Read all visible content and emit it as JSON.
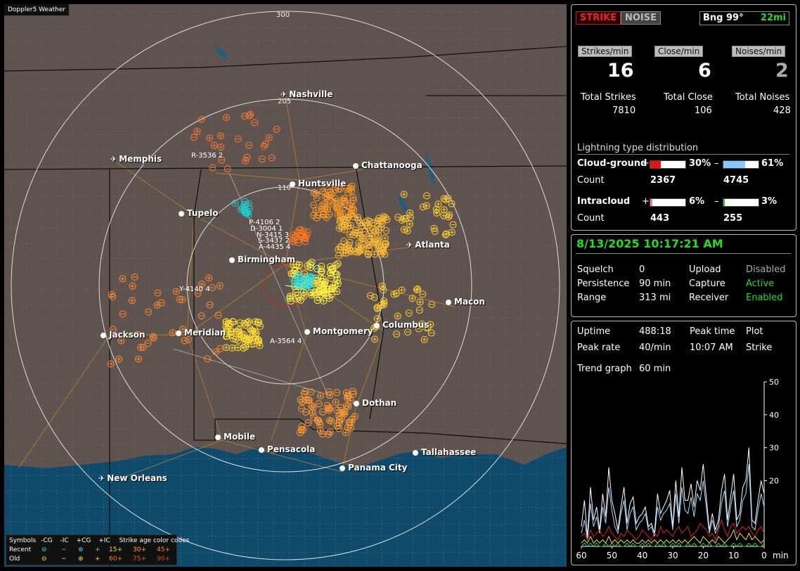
{
  "map": {
    "brand": "Doppler5 Weather",
    "ring_labels": [
      "300",
      "205",
      "110"
    ],
    "cities": [
      {
        "name": "Nashville",
        "icon": "airport-icon"
      },
      {
        "name": "Memphis",
        "icon": "airport-icon"
      },
      {
        "name": "Chattanooga",
        "icon": "city-dot"
      },
      {
        "name": "Huntsville",
        "icon": "city-dot"
      },
      {
        "name": "Tupelo",
        "icon": "city-dot"
      },
      {
        "name": "Atlanta",
        "icon": "airport-icon"
      },
      {
        "name": "Birmingham",
        "icon": "city-dot"
      },
      {
        "name": "Macon",
        "icon": "city-dot"
      },
      {
        "name": "Jackson",
        "icon": "city-dot"
      },
      {
        "name": "Meridian",
        "icon": "city-dot"
      },
      {
        "name": "Montgomery",
        "icon": "city-dot"
      },
      {
        "name": "Columbus",
        "icon": "city-dot"
      },
      {
        "name": "Dothan",
        "icon": "city-dot"
      },
      {
        "name": "Mobile",
        "icon": "city-dot"
      },
      {
        "name": "Pensacola",
        "icon": "city-dot"
      },
      {
        "name": "Tallahassee",
        "icon": "city-dot"
      },
      {
        "name": "Panama City",
        "icon": "city-dot"
      },
      {
        "name": "New Orleans",
        "icon": "airport-icon"
      }
    ],
    "stations": [
      "R-3536 2",
      "P-4106 2",
      "D-3004 1",
      "N-3415 3",
      "S-3437 2",
      "A-4435 4",
      "Y-4140 4",
      "A-3564 4"
    ],
    "legend": {
      "header": [
        "Symbols",
        "-CG",
        "-IC",
        "+CG",
        "+IC",
        "Strike age color codes"
      ],
      "recent_label": "Recent",
      "old_label": "Old",
      "recent_ages": [
        "15+",
        "30+",
        "45+"
      ],
      "old_ages": [
        "60+",
        "75+",
        "90+"
      ]
    }
  },
  "panel1": {
    "strike_button": "STRIKE",
    "noise_button": "NOISE",
    "bearing": "Bng 99°",
    "distance": "22mi",
    "headers": [
      "Strikes/min",
      "Close/min",
      "Noises/min"
    ],
    "big_values": [
      "16",
      "6",
      "2"
    ],
    "totals_labels": [
      "Total Strikes",
      "Total Close",
      "Total Noises"
    ],
    "totals_values": [
      "7810",
      "106",
      "428"
    ],
    "dist_title": "Lightning type distribution",
    "cg_label": "Cloud-ground",
    "ic_label": "Intracloud",
    "count_label": "Count",
    "plus": "+",
    "minus": "–",
    "cg_pos_pct": "30%",
    "cg_neg_pct": "61%",
    "cg_pos_count": "2367",
    "cg_neg_count": "4745",
    "ic_pos_pct": "6%",
    "ic_neg_pct": "3%",
    "ic_pos_count": "443",
    "ic_neg_count": "255",
    "cg_pos_frac": 0.3,
    "cg_neg_frac": 0.61,
    "ic_pos_frac": 0.06,
    "ic_neg_frac": 0.03
  },
  "panel2": {
    "datetime": "8/13/2025 10:17:21 AM",
    "squelch_label": "Squelch",
    "squelch": "0",
    "persistence_label": "Persistence",
    "persistence": "90 min",
    "range_label": "Range",
    "range": "313 mi",
    "upload_label": "Upload",
    "upload": "Disabled",
    "capture_label": "Capture",
    "capture": "Active",
    "receiver_label": "Receiver",
    "receiver": "Enabled"
  },
  "panel3": {
    "uptime_label": "Uptime",
    "uptime": "488:18",
    "peak_time_label": "Peak time",
    "peak_time": "10:07 AM",
    "plot_label": "Plot",
    "plot": "Strike",
    "peak_rate_label": "Peak rate",
    "peak_rate": "40/min",
    "trend_label": "Trend graph",
    "trend": "60 min"
  },
  "chart_data": {
    "type": "line",
    "x": [
      60,
      59,
      58,
      57,
      56,
      55,
      54,
      53,
      52,
      51,
      50,
      49,
      48,
      47,
      46,
      45,
      44,
      43,
      42,
      41,
      40,
      39,
      38,
      37,
      36,
      35,
      34,
      33,
      32,
      31,
      30,
      29,
      28,
      27,
      26,
      25,
      24,
      23,
      22,
      21,
      20,
      19,
      18,
      17,
      16,
      15,
      14,
      13,
      12,
      11,
      10,
      9,
      8,
      7,
      6,
      5,
      4,
      3,
      2,
      1,
      0
    ],
    "xticks": [
      "60",
      "50",
      "40",
      "30",
      "20",
      "10",
      "0"
    ],
    "xunit": "min",
    "yticks": [
      "50",
      "40",
      "30",
      "20"
    ],
    "ylim": [
      0,
      50
    ],
    "series": [
      {
        "color": "#ffffff",
        "values": [
          6,
          14,
          3,
          18,
          8,
          12,
          5,
          16,
          9,
          24,
          14,
          10,
          5,
          12,
          18,
          7,
          13,
          15,
          7,
          9,
          10,
          12,
          6,
          7,
          4,
          16,
          10,
          12,
          14,
          17,
          6,
          20,
          9,
          24,
          14,
          14,
          19,
          12,
          20,
          17,
          25,
          15,
          5,
          10,
          5,
          8,
          17,
          22,
          8,
          15,
          22,
          8,
          10,
          18,
          20,
          30,
          8,
          7,
          14,
          20,
          16
        ]
      },
      {
        "color": "#a8d8ff",
        "values": [
          4,
          8,
          2,
          13,
          6,
          9,
          4,
          12,
          7,
          18,
          11,
          6,
          4,
          10,
          14,
          5,
          10,
          12,
          5,
          7,
          8,
          10,
          5,
          6,
          3,
          12,
          8,
          10,
          11,
          13,
          5,
          16,
          7,
          18,
          11,
          10,
          15,
          9,
          16,
          14,
          20,
          12,
          4,
          8,
          4,
          6,
          13,
          17,
          6,
          12,
          17,
          6,
          8,
          14,
          16,
          25,
          6,
          5,
          11,
          16,
          12
        ]
      },
      {
        "color": "#dd2222",
        "values": [
          3,
          4,
          2,
          5,
          3,
          4,
          5,
          3,
          4,
          6,
          4,
          3,
          2,
          4,
          3,
          5,
          4,
          3,
          2,
          3,
          5,
          4,
          3,
          2,
          4,
          3,
          6,
          4,
          5,
          4,
          3,
          5,
          6,
          4,
          5,
          6,
          3,
          4,
          5,
          7,
          6,
          5,
          3,
          4,
          2,
          5,
          8,
          5,
          3,
          6,
          7,
          4,
          5,
          6,
          5,
          6,
          4,
          3,
          5,
          6,
          4
        ]
      },
      {
        "color": "#eedd55",
        "values": [
          1,
          2,
          1,
          3,
          1,
          2,
          1,
          2,
          1,
          3,
          1,
          2,
          1,
          2,
          1,
          2,
          1,
          2,
          1,
          1,
          2,
          1,
          2,
          1,
          2,
          1,
          2,
          1,
          2,
          1,
          2,
          1,
          2,
          1,
          2,
          1,
          2,
          3,
          2,
          1,
          3,
          2,
          1,
          2,
          1,
          3,
          2,
          1,
          2,
          3,
          5,
          2,
          4,
          3,
          2,
          4,
          2,
          3,
          2,
          1,
          2
        ]
      },
      {
        "color": "#33cc33",
        "values": [
          0,
          1,
          0,
          1,
          0,
          1,
          0,
          0,
          1,
          0,
          1,
          0,
          1,
          0,
          0,
          1,
          0,
          1,
          0,
          0,
          1,
          0,
          1,
          0,
          0,
          1,
          0,
          1,
          0,
          0,
          1,
          0,
          1,
          0,
          0,
          1,
          0,
          1,
          0,
          0,
          1,
          0,
          1,
          0,
          0,
          1,
          0,
          1,
          0,
          0,
          1,
          0,
          1,
          0,
          0,
          1,
          0,
          1,
          0,
          0,
          1
        ]
      }
    ]
  }
}
